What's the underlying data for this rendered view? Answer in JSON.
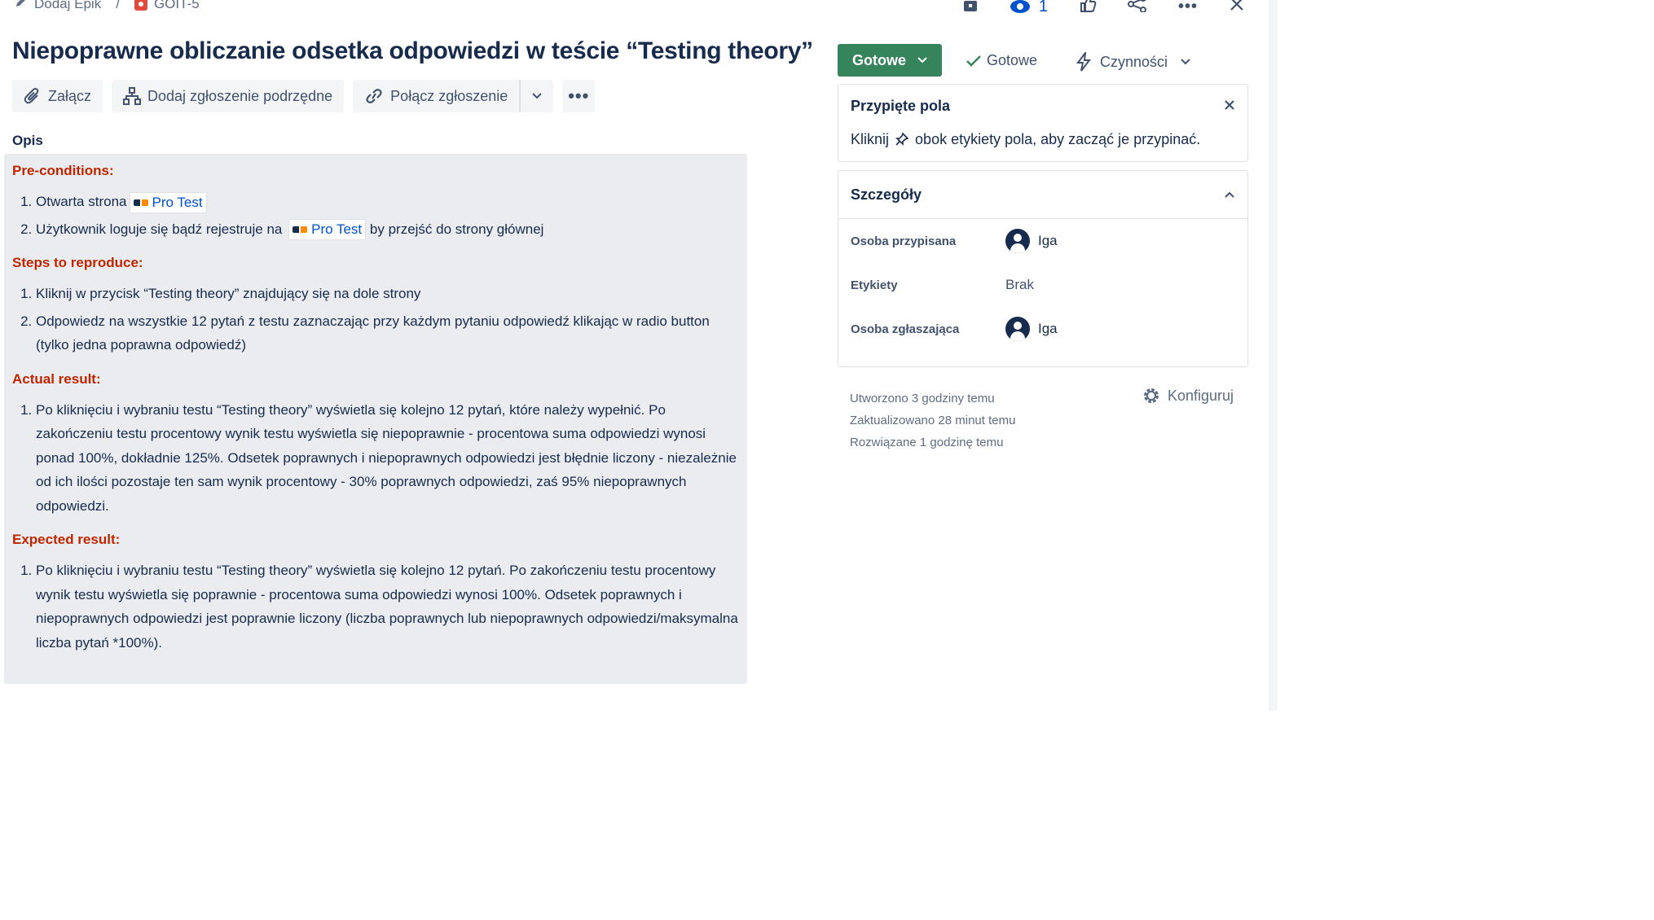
{
  "breadcrumb": {
    "add_epic": "Dodaj Epik",
    "separator": "/",
    "issue_key": "GOIT-5"
  },
  "top_actions": {
    "watchers_count": "1"
  },
  "issue": {
    "title": "Niepoprawne obliczanie odsetka odpowiedzi w teście “Testing theory”"
  },
  "toolbar": {
    "attach": "Załącz",
    "add_child": "Dodaj zgłoszenie podrzędne",
    "link_issue": "Połącz zgłoszenie"
  },
  "description": {
    "label": "Opis",
    "preconditions_heading": "Pre-conditions:",
    "pre1_text": "Otwarta strona",
    "pre2_text": "Użytkownik loguje się bądź rejestruje na",
    "pre2_suffix": "by przejść do strony głównej",
    "link_label": "Pro Test",
    "steps_heading": "Steps to reproduce:",
    "step1": "Kliknij w przycisk “Testing theory” znajdujący się na dole strony",
    "step2": "Odpowiedz na wszystkie 12 pytań z testu zaznaczając przy każdym pytaniu odpowiedź klikając w radio button (tylko jedna poprawna odpowiedź)",
    "actual_heading": "Actual result:",
    "actual1": "Po kliknięciu i wybraniu testu “Testing theory” wyświetla się kolejno 12 pytań, które należy wypełnić. Po zakończeniu testu procentowy wynik testu wyświetla się niepoprawnie - procentowa suma odpowiedzi wynosi ponad 100%, dokładnie 125%. Odsetek poprawnych i niepoprawnych odpowiedzi jest błędnie liczony - niezależnie od ich ilości pozostaje ten sam wynik procentowy - 30% poprawnych odpowiedzi, zaś 95% niepoprawnych odpowiedzi.",
    "expected_heading": "Expected result:",
    "expected1": "Po kliknięciu i wybraniu testu “Testing theory” wyświetla się kolejno 12 pytań. Po zakończeniu testu procentowy wynik testu wyświetla się poprawnie - procentowa suma odpowiedzi wynosi 100%. Odsetek poprawnych i niepoprawnych odpowiedzi jest poprawnie liczony (liczba poprawnych lub niepoprawnych odpowiedzi/maksymalna liczba pytań *100%)."
  },
  "status": {
    "button": "Gotowe",
    "resolution": "Gotowe",
    "actions": "Czynności"
  },
  "pinned": {
    "title": "Przypięte pola",
    "hint_before": "Kliknij",
    "hint_after": "obok etykiety pola, aby zacząć je przypinać."
  },
  "details": {
    "title": "Szczegóły",
    "assignee_label": "Osoba przypisana",
    "assignee_value": "Iga",
    "labels_label": "Etykiety",
    "labels_value": "Brak",
    "reporter_label": "Osoba zgłaszająca",
    "reporter_value": "Iga"
  },
  "meta": {
    "created": "Utworzono 3 godziny temu",
    "updated": "Zaktualizowano 28 minut temu",
    "resolved": "Rozwiązane 1 godzinę temu",
    "configure": "Konfiguruj"
  },
  "colors": {
    "status_green": "#36845b",
    "heading_red": "#bf2600",
    "link_blue": "#0052cc"
  }
}
